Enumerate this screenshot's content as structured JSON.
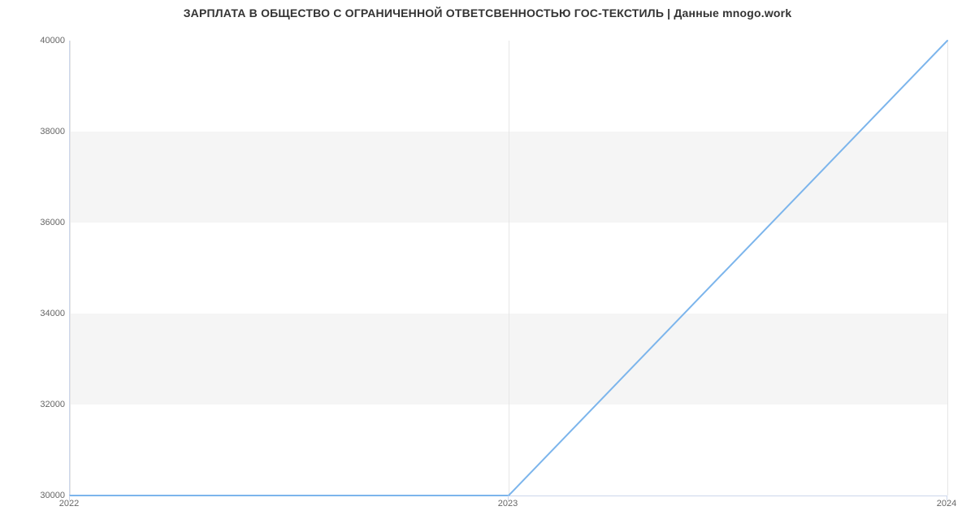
{
  "chart_data": {
    "type": "line",
    "title": "ЗАРПЛАТА В ОБЩЕСТВО С ОГРАНИЧЕННОЙ ОТВЕТСВЕННОСТЬЮ ГОС-ТЕКСТИЛЬ | Данные mnogo.work",
    "xlabel": "",
    "ylabel": "",
    "x": [
      2022,
      2023,
      2024
    ],
    "values": [
      30000,
      30000,
      40000
    ],
    "x_ticks": [
      2022,
      2023,
      2024
    ],
    "y_ticks": [
      30000,
      32000,
      34000,
      36000,
      38000,
      40000
    ],
    "xlim": [
      2022,
      2024
    ],
    "ylim": [
      30000,
      40000
    ],
    "grid_bands": true,
    "series_color": "#7cb5ec"
  }
}
